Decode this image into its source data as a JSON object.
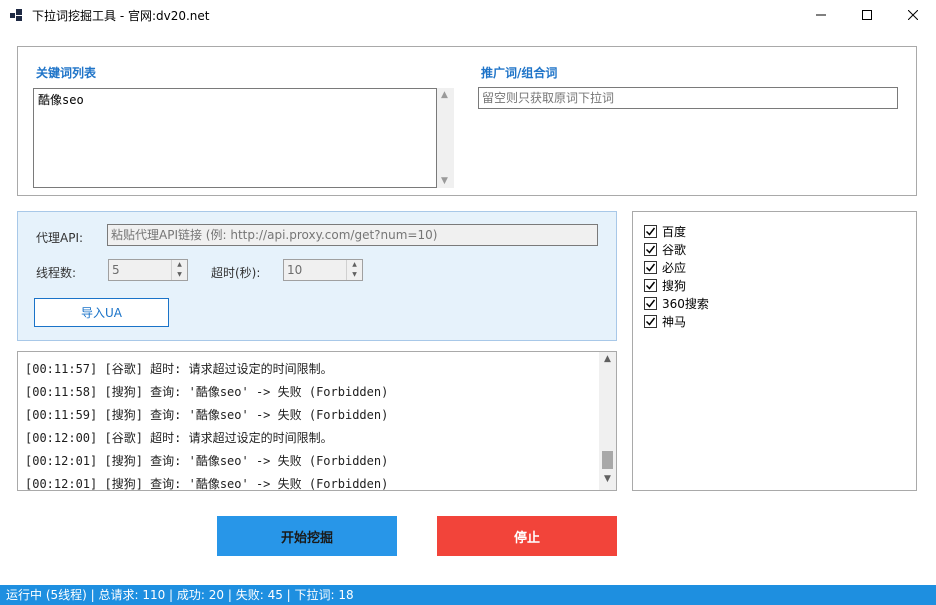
{
  "window": {
    "title": "下拉词挖掘工具 - 官网:dv20.net",
    "icon": "app-grid-icon"
  },
  "keywords": {
    "label": "关键词列表",
    "value": "酷像seo"
  },
  "promo": {
    "label": "推广词/组合词",
    "placeholder": "留空则只获取原词下拉词"
  },
  "proxy": {
    "api_label": "代理API:",
    "api_placeholder": "粘贴代理API链接 (例: http://api.proxy.com/get?num=10)",
    "threads_label": "线程数:",
    "threads_value": "5",
    "timeout_label": "超时(秒):",
    "timeout_value": "10",
    "import_ua_label": "导入UA"
  },
  "log": {
    "lines": [
      "[00:11:57] [谷歌] 超时: 请求超过设定的时间限制。",
      "[00:11:58] [搜狗] 查询: '酷像seo' -> 失败 (Forbidden)",
      "[00:11:59] [搜狗] 查询: '酷像seo' -> 失败 (Forbidden)",
      "[00:12:00] [谷歌] 超时: 请求超过设定的时间限制。",
      "[00:12:01] [搜狗] 查询: '酷像seo' -> 失败 (Forbidden)",
      "[00:12:01] [搜狗] 查询: '酷像seo' -> 失败 (Forbidden)"
    ]
  },
  "engines": [
    {
      "label": "百度",
      "checked": true
    },
    {
      "label": "谷歌",
      "checked": true
    },
    {
      "label": "必应",
      "checked": true
    },
    {
      "label": "搜狗",
      "checked": true
    },
    {
      "label": "360搜索",
      "checked": true
    },
    {
      "label": "神马",
      "checked": true
    }
  ],
  "actions": {
    "start_label": "开始挖掘",
    "stop_label": "停止"
  },
  "status": {
    "text": "运行中 (5线程) | 总请求: 110 | 成功: 20 | 失败: 45 | 下拉词: 18"
  },
  "colors": {
    "accent": "#1f74c8",
    "start_button": "#2896e8",
    "stop_button": "#f2443a",
    "statusbar": "#1e8fe0",
    "proxy_panel": "#e6f2fb"
  }
}
